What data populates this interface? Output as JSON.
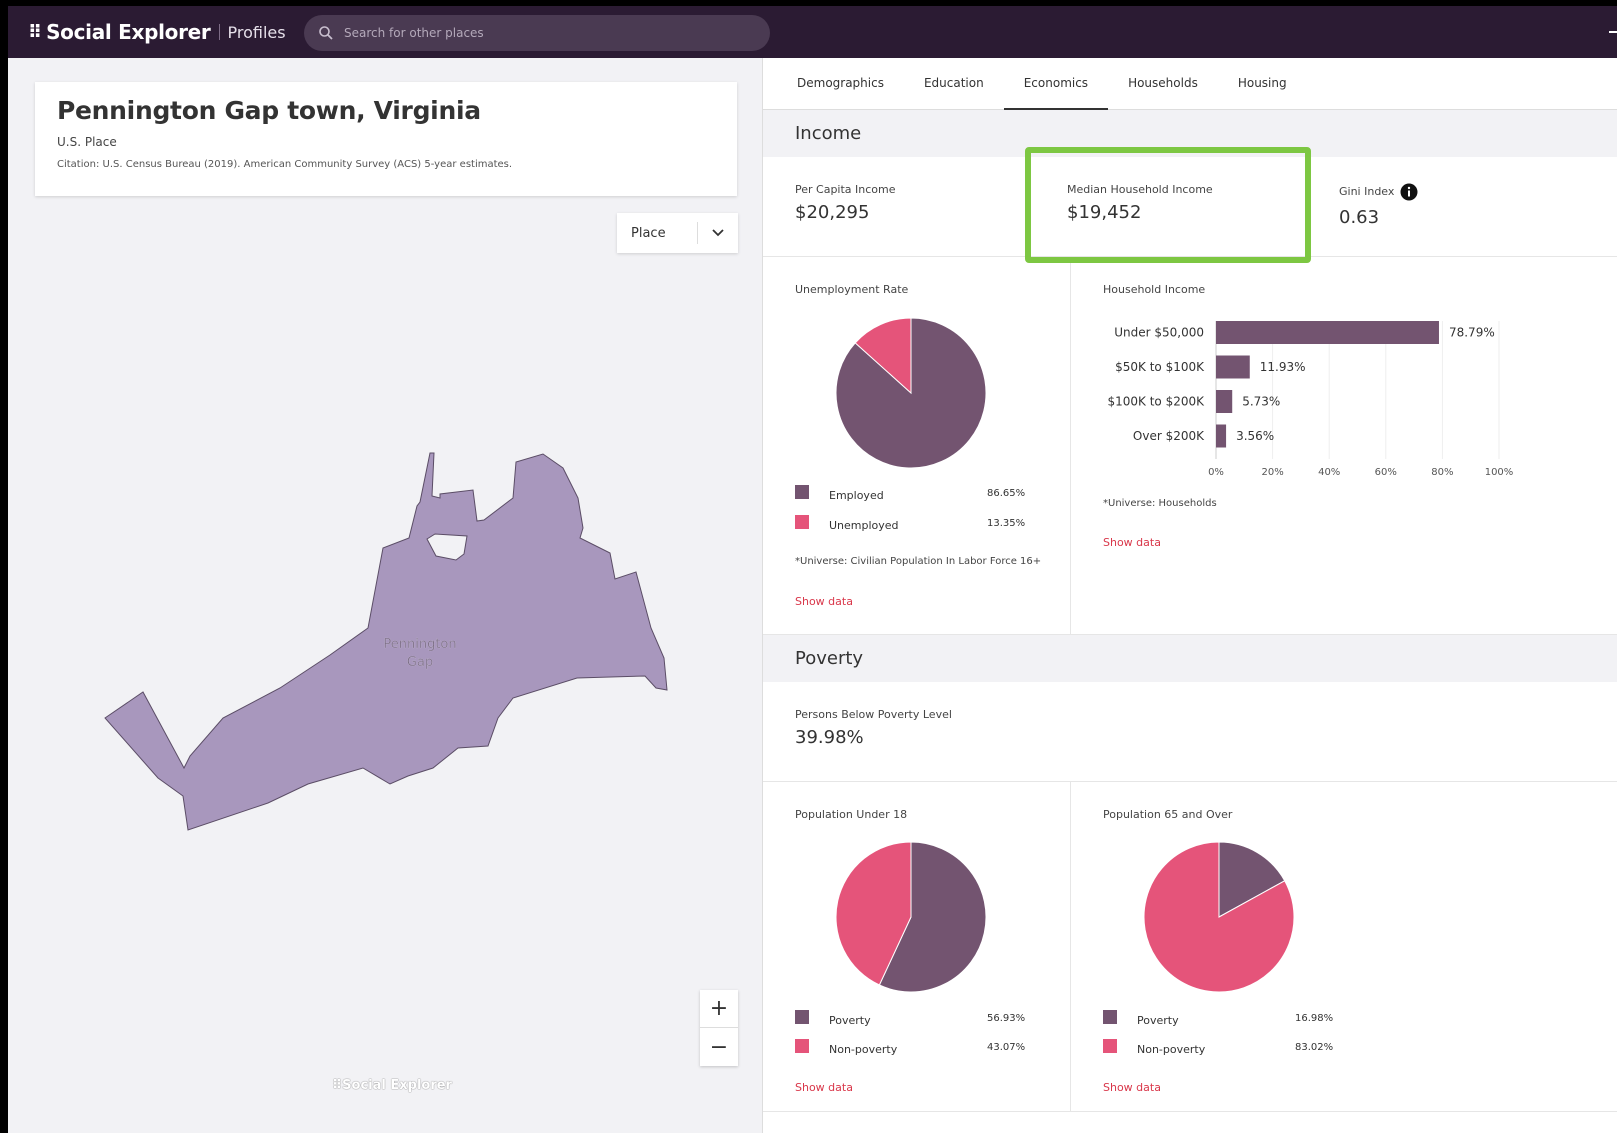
{
  "app": {
    "brand_dots": "⠿",
    "brand_name": "Social Explorer",
    "brand_sub": "Profiles",
    "search_placeholder": "Search for other places"
  },
  "place": {
    "title": "Pennington Gap town, Virginia",
    "type": "U.S. Place",
    "citation": "Citation: U.S. Census Bureau (2019). American Community Survey (ACS) 5-year estimates.",
    "geo_select": "Place",
    "map_label_line1": "Pennington",
    "map_label_line2": "Gap",
    "map_logo": "⠿Social Explorer",
    "zoom_in": "+",
    "zoom_out": "−"
  },
  "tabs": [
    {
      "label": "Demographics"
    },
    {
      "label": "Education"
    },
    {
      "label": "Economics"
    },
    {
      "label": "Households"
    },
    {
      "label": "Housing"
    }
  ],
  "active_tab": "Economics",
  "income": {
    "header": "Income",
    "per_capita_label": "Per Capita Income",
    "per_capita_value": "$20,295",
    "median_label": "Median Household Income",
    "median_value": "$19,452",
    "gini_label": "Gini Index",
    "gini_value": "0.63"
  },
  "poverty": {
    "header": "Poverty",
    "below_label": "Persons Below Poverty Level",
    "below_value": "39.98%"
  },
  "show_data": "Show data",
  "colors": {
    "primary": "#735470",
    "secondary": "#e5547a",
    "nav": "#2b1b33",
    "highlight": "#7dc742",
    "map_fill": "#a897bd"
  },
  "chart_data": [
    {
      "type": "pie",
      "title": "Unemployment Rate",
      "categories": [
        "Employed",
        "Unemployed"
      ],
      "values": [
        86.65,
        13.35
      ],
      "value_labels": [
        "86.65%",
        "13.35%"
      ],
      "universe": "*Universe: Civilian Population In Labor Force 16+"
    },
    {
      "type": "bar",
      "orientation": "horizontal",
      "title": "Household Income",
      "categories": [
        "Under $50,000",
        "$50K to $100K",
        "$100K to $200K",
        "Over $200K"
      ],
      "values": [
        78.79,
        11.93,
        5.73,
        3.56
      ],
      "value_labels": [
        "78.79%",
        "11.93%",
        "5.73%",
        "3.56%"
      ],
      "xlim": [
        0,
        100
      ],
      "xticks": [
        "0%",
        "20%",
        "40%",
        "60%",
        "80%",
        "100%"
      ],
      "universe": "*Universe: Households"
    },
    {
      "type": "pie",
      "title": "Population Under 18",
      "categories": [
        "Poverty",
        "Non-poverty"
      ],
      "values": [
        56.93,
        43.07
      ],
      "value_labels": [
        "56.93%",
        "43.07%"
      ]
    },
    {
      "type": "pie",
      "title": "Population 65 and Over",
      "categories": [
        "Poverty",
        "Non-poverty"
      ],
      "values": [
        16.98,
        83.02
      ],
      "value_labels": [
        "16.98%",
        "83.02%"
      ]
    }
  ]
}
